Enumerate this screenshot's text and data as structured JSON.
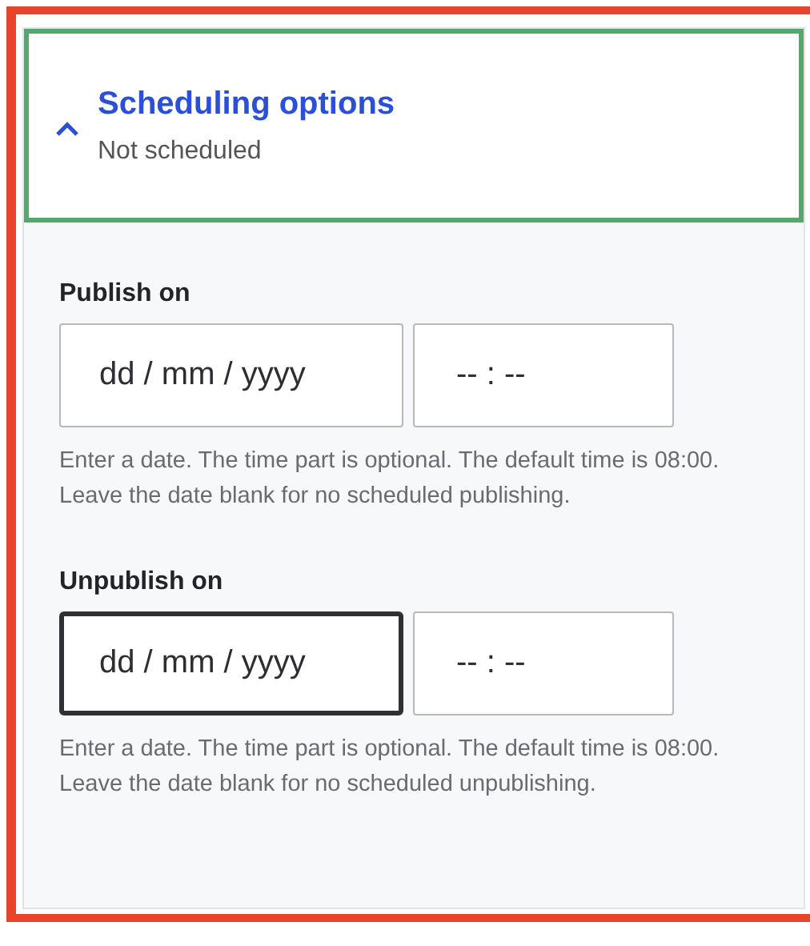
{
  "scheduling": {
    "title": "Scheduling options",
    "summary": "Not scheduled",
    "expanded": true,
    "fields": [
      {
        "label": "Publish on",
        "date": {
          "placeholder": "dd / mm / yyyy",
          "focused": false
        },
        "time": {
          "placeholder": "-- : --",
          "focused": false
        },
        "help": "Enter a date. The time part is optional. The default time is 08:00. Leave the date blank for no scheduled publishing."
      },
      {
        "label": "Unpublish on",
        "date": {
          "placeholder": "dd / mm / yyyy",
          "focused": true
        },
        "time": {
          "placeholder": "-- : --",
          "focused": false
        },
        "help": "Enter a date. The time part is optional. The default time is 08:00. Leave the date blank for no scheduled unpublishing."
      }
    ]
  }
}
